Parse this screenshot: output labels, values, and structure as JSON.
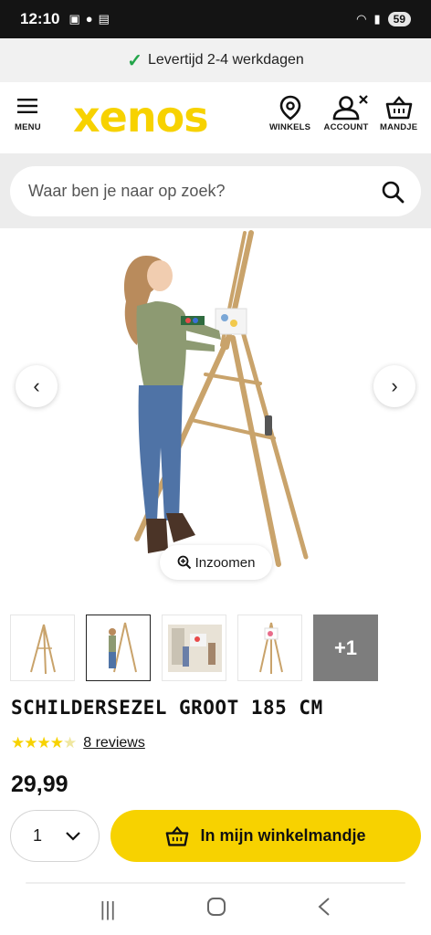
{
  "status": {
    "time": "12:10",
    "battery": "59"
  },
  "notice": {
    "text": "Levertijd 2-4 werkdagen"
  },
  "header": {
    "brand": "xenos",
    "menu_label": "MENU",
    "stores_label": "WINKELS",
    "account_label": "ACCOUNT",
    "cart_label": "MANDJE",
    "brand_color": "#f7d200"
  },
  "search": {
    "placeholder": "Waar ben je naar op zoek?"
  },
  "gallery": {
    "zoom_label": "Inzoomen",
    "more_count": "+1"
  },
  "product": {
    "title": "SCHILDERSEZEL GROOT 185 CM",
    "rating": 4.5,
    "reviews_label": "8 reviews",
    "price": "29,99",
    "quantity": "1",
    "add_to_cart_label": "In mijn winkelmandje"
  }
}
